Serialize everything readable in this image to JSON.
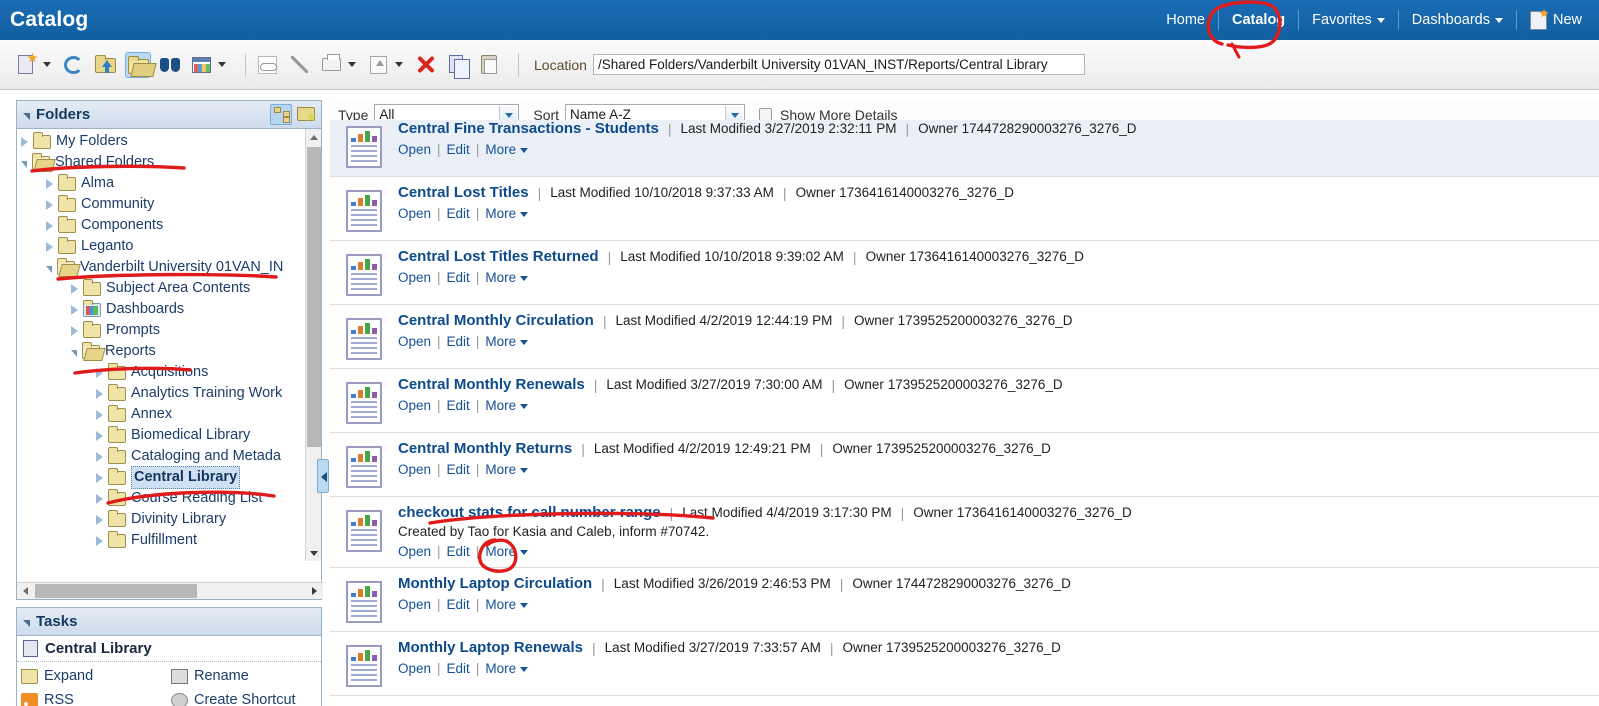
{
  "header": {
    "app_title": "Catalog",
    "nav": [
      {
        "label": "Home",
        "active": false
      },
      {
        "label": "Catalog",
        "active": true
      },
      {
        "label": "Favorites",
        "active": false,
        "caret": true
      },
      {
        "label": "Dashboards",
        "active": false,
        "caret": true
      }
    ],
    "new_button": "New"
  },
  "toolbar": {
    "icons": [
      {
        "name": "new-object-icon",
        "caret": true
      },
      {
        "name": "refresh-icon",
        "caret": false
      },
      {
        "name": "up-one-level-icon",
        "caret": false
      },
      {
        "name": "show-folders-icon",
        "caret": false,
        "selected": true
      },
      {
        "name": "search-icon",
        "caret": false
      },
      {
        "name": "view-layout-icon",
        "caret": true
      },
      {
        "name": "preview-icon",
        "caret": false
      },
      {
        "name": "edit-icon",
        "caret": false
      },
      {
        "name": "print-icon",
        "caret": true
      },
      {
        "name": "export-icon",
        "caret": true
      },
      {
        "name": "delete-icon",
        "caret": false
      },
      {
        "name": "copy-icon",
        "caret": false
      },
      {
        "name": "paste-icon",
        "caret": false
      }
    ],
    "location_label": "Location",
    "location_value": "/Shared Folders/Vanderbilt University 01VAN_INST/Reports/Central Library"
  },
  "folders_panel": {
    "title": "Folders",
    "buttons": [
      {
        "name": "tree-view-button",
        "selected": true
      },
      {
        "name": "add-favorite-folder-button",
        "selected": false
      }
    ],
    "tree": [
      {
        "label": "My Folders",
        "indent": 0,
        "arrow": "closed",
        "folder": "closed",
        "selected": false
      },
      {
        "label": "Shared Folders",
        "indent": 0,
        "arrow": "open",
        "folder": "open",
        "selected": false
      },
      {
        "label": "Alma",
        "indent": 1,
        "arrow": "closed",
        "folder": "closed",
        "selected": false
      },
      {
        "label": "Community",
        "indent": 1,
        "arrow": "closed",
        "folder": "closed",
        "selected": false
      },
      {
        "label": "Components",
        "indent": 1,
        "arrow": "closed",
        "folder": "closed",
        "selected": false
      },
      {
        "label": "Leganto",
        "indent": 1,
        "arrow": "closed",
        "folder": "closed",
        "selected": false
      },
      {
        "label": "Vanderbilt University 01VAN_IN",
        "indent": 1,
        "arrow": "open",
        "folder": "open",
        "selected": false
      },
      {
        "label": "Subject Area Contents",
        "indent": 2,
        "arrow": "closed",
        "folder": "closed",
        "selected": false
      },
      {
        "label": "Dashboards",
        "indent": 2,
        "arrow": "closed",
        "folder": "dash",
        "selected": false
      },
      {
        "label": "Prompts",
        "indent": 2,
        "arrow": "closed",
        "folder": "closed",
        "selected": false
      },
      {
        "label": "Reports",
        "indent": 2,
        "arrow": "open",
        "folder": "open",
        "selected": false
      },
      {
        "label": "Acquisitions",
        "indent": 3,
        "arrow": "closed",
        "folder": "closed",
        "selected": false
      },
      {
        "label": "Analytics Training Work",
        "indent": 3,
        "arrow": "closed",
        "folder": "closed",
        "selected": false
      },
      {
        "label": "Annex",
        "indent": 3,
        "arrow": "closed",
        "folder": "closed",
        "selected": false
      },
      {
        "label": "Biomedical Library",
        "indent": 3,
        "arrow": "closed",
        "folder": "closed",
        "selected": false
      },
      {
        "label": "Cataloging and Metada",
        "indent": 3,
        "arrow": "closed",
        "folder": "closed",
        "selected": false
      },
      {
        "label": "Central Library",
        "indent": 3,
        "arrow": "closed",
        "folder": "closed",
        "selected": true
      },
      {
        "label": "Course Reading List",
        "indent": 3,
        "arrow": "closed",
        "folder": "closed",
        "selected": false
      },
      {
        "label": "Divinity Library",
        "indent": 3,
        "arrow": "closed",
        "folder": "closed",
        "selected": false
      },
      {
        "label": "Fulfillment",
        "indent": 3,
        "arrow": "closed",
        "folder": "closed",
        "selected": false
      }
    ]
  },
  "tasks_panel": {
    "title": "Tasks",
    "context_name": "Central Library",
    "items": [
      {
        "label": "Expand",
        "icon": "folder-icon"
      },
      {
        "label": "Rename",
        "icon": "rename-icon"
      },
      {
        "label": "RSS",
        "icon": "rss-icon"
      },
      {
        "label": "Create Shortcut",
        "icon": "shortcut-icon"
      }
    ]
  },
  "filters": {
    "type_label": "Type",
    "type_value": "All",
    "sort_label": "Sort",
    "sort_value": "Name A-Z",
    "show_more_details_label": "Show More Details",
    "show_more_details_checked": false
  },
  "actions": {
    "open": "Open",
    "edit": "Edit",
    "more": "More"
  },
  "labels": {
    "last_modified": "Last Modified",
    "owner": "Owner"
  },
  "items": [
    {
      "title": "Central Fine Transactions - Students",
      "modified": "3/27/2019 2:32:11 PM",
      "owner": "1744728290003276_3276_D",
      "description": ""
    },
    {
      "title": "Central Lost Titles",
      "modified": "10/10/2018 9:37:33 AM",
      "owner": "1736416140003276_3276_D",
      "description": ""
    },
    {
      "title": "Central Lost Titles Returned",
      "modified": "10/10/2018 9:39:02 AM",
      "owner": "1736416140003276_3276_D",
      "description": ""
    },
    {
      "title": "Central Monthly Circulation",
      "modified": "4/2/2019 12:44:19 PM",
      "owner": "1739525200003276_3276_D",
      "description": ""
    },
    {
      "title": "Central Monthly Renewals",
      "modified": "3/27/2019 7:30:00 AM",
      "owner": "1739525200003276_3276_D",
      "description": ""
    },
    {
      "title": "Central Monthly Returns",
      "modified": "4/2/2019 12:49:21 PM",
      "owner": "1739525200003276_3276_D",
      "description": ""
    },
    {
      "title": "checkout stats for call number range",
      "modified": "4/4/2019 3:17:30 PM",
      "owner": "1736416140003276_3276_D",
      "description": "Created by Tao for Kasia and Caleb, inform #70742."
    },
    {
      "title": "Monthly Laptop Circulation",
      "modified": "3/26/2019 2:46:53 PM",
      "owner": "1744728290003276_3276_D",
      "description": ""
    },
    {
      "title": "Monthly Laptop Renewals",
      "modified": "3/27/2019 7:33:57 AM",
      "owner": "1739525200003276_3276_D",
      "description": ""
    }
  ],
  "annotations": {
    "color": "#e01b1b",
    "marks": [
      {
        "name": "circle-catalog-nav",
        "shape": "ellipse"
      },
      {
        "name": "underline-shared-folders",
        "shape": "line"
      },
      {
        "name": "underline-vanderbilt-university",
        "shape": "line"
      },
      {
        "name": "underline-reports",
        "shape": "line"
      },
      {
        "name": "underline-central-library",
        "shape": "line"
      },
      {
        "name": "underline-checkout-stats-title",
        "shape": "line"
      },
      {
        "name": "circle-edit-link",
        "shape": "ellipse"
      }
    ]
  },
  "colors": {
    "header_blue": "#1566b0",
    "link_blue": "#0d4a8c",
    "annotation_red": "#e01b1b",
    "panel_border": "#9ab2c8"
  }
}
